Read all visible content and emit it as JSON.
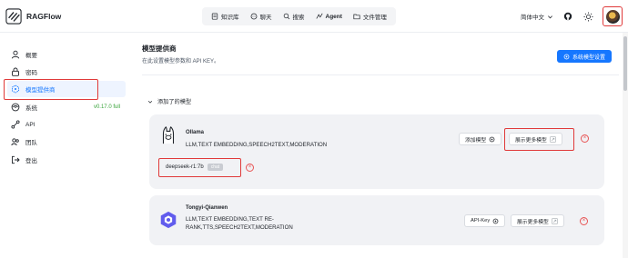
{
  "app": {
    "name": "RAGFlow"
  },
  "nav": [
    {
      "label": "知识库",
      "icon": "book-icon"
    },
    {
      "label": "聊天",
      "icon": "chat-icon"
    },
    {
      "label": "搜索",
      "icon": "search-icon"
    },
    {
      "label": "Agent",
      "icon": "agent-icon"
    },
    {
      "label": "文件管理",
      "icon": "folder-icon"
    }
  ],
  "header": {
    "language": "简体中文"
  },
  "sidebar": {
    "items": [
      {
        "label": "概要",
        "icon": "user-icon"
      },
      {
        "label": "密码",
        "icon": "lock-icon"
      },
      {
        "label": "模型提供商",
        "icon": "cube-icon",
        "active": true
      },
      {
        "label": "系统",
        "icon": "system-icon",
        "version": "v0.17.0 full"
      },
      {
        "label": "API",
        "icon": "api-icon"
      },
      {
        "label": "团队",
        "icon": "team-icon"
      },
      {
        "label": "登出",
        "icon": "logout-icon"
      }
    ]
  },
  "main": {
    "title": "模型提供商",
    "subtitle": "在此设置模型参数和 API KEY。",
    "system_button": "系统模型设置",
    "added_models_label": "添加了的模型"
  },
  "providers": [
    {
      "name": "Ollama",
      "tags": "LLM,TEXT EMBEDDING,SPEECH2TEXT,MODERATION",
      "primary_button": "添加模型",
      "show_more_button": "展示更多模型",
      "model": {
        "name": "deepseek-r1:7b",
        "badge": "chat"
      }
    },
    {
      "name": "Tongyi-Qianwen",
      "tags_line1": "LLM,TEXT EMBEDDING,TEXT RE-",
      "tags_line2": "RANK,TTS,SPEECH2TEXT,MODERATION",
      "primary_button": "API-Key",
      "show_more_button": "展示更多模型"
    }
  ],
  "colors": {
    "accent": "#1677ff",
    "highlight": "#e03a3a",
    "card_bg": "#f1f2f5",
    "version": "#38a33a"
  }
}
